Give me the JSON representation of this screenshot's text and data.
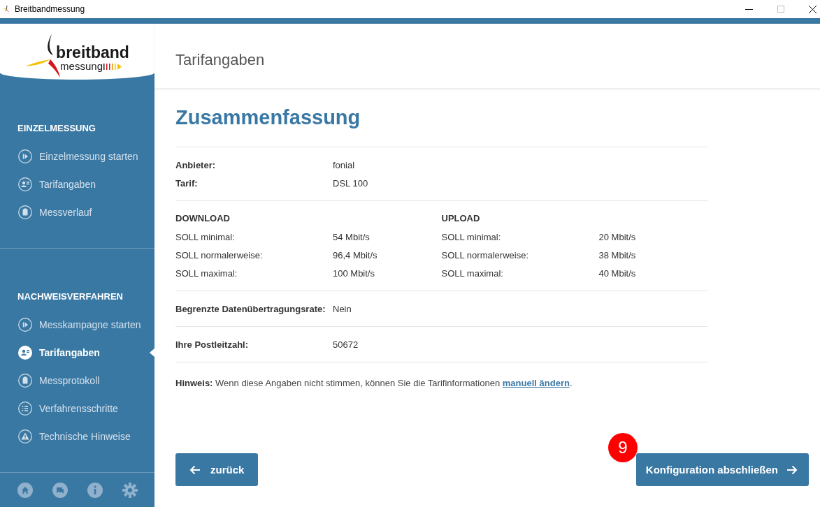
{
  "window": {
    "title": "Breitbandmessung"
  },
  "logo": {
    "line_1": "breitband",
    "line_2": "messung"
  },
  "sidebar": {
    "sections": [
      {
        "heading": "EINZELMESSUNG",
        "items": [
          {
            "label": "Einzelmessung starten",
            "kind": "play",
            "selected": false
          },
          {
            "label": "Tarifangaben",
            "kind": "person",
            "selected": false
          },
          {
            "label": "Messverlauf",
            "kind": "clipboard",
            "selected": false
          }
        ]
      },
      {
        "heading": "NACHWEISVERFAHREN",
        "items": [
          {
            "label": "Messkampagne starten",
            "kind": "play",
            "selected": false
          },
          {
            "label": "Tarifangaben",
            "kind": "person",
            "selected": true
          },
          {
            "label": "Messprotokoll",
            "kind": "clipboard",
            "selected": false
          },
          {
            "label": "Verfahrensschritte",
            "kind": "list",
            "selected": false
          },
          {
            "label": "Technische Hinweise",
            "kind": "warning",
            "selected": false
          }
        ]
      }
    ]
  },
  "page_title": "Tarifangaben",
  "heading": "Zusammenfassung",
  "contract": [
    {
      "label": "Anbieter:",
      "value": "fonial"
    },
    {
      "label": "Tarif:",
      "value": "DSL 100"
    }
  ],
  "speeds": [
    {
      "heading": "DOWNLOAD",
      "rows": [
        {
          "label": "SOLL minimal:",
          "value": "54 Mbit/s"
        },
        {
          "label": "SOLL normalerweise:",
          "value": "96,4 Mbit/s"
        },
        {
          "label": "SOLL maximal:",
          "value": "100 Mbit/s"
        }
      ]
    },
    {
      "heading": "UPLOAD",
      "rows": [
        {
          "label": "SOLL minimal:",
          "value": "20 Mbit/s"
        },
        {
          "label": "SOLL normalerweise:",
          "value": "38 Mbit/s"
        },
        {
          "label": "SOLL maximal:",
          "value": "40 Mbit/s"
        }
      ]
    }
  ],
  "details": [
    {
      "label": "Begrenzte Datenübertragungsrate:",
      "value": "Nein"
    },
    {
      "label": "Ihre Postleitzahl:",
      "value": "50672"
    }
  ],
  "hint": {
    "text": "**Hinweis:** Wenn diese Angaben nicht stimmen, können Sie die Tarifinformationen ",
    "link": "manuell ändern",
    "after": "."
  },
  "buttons": {
    "back": "zurück",
    "finish": "Konfiguration abschließen"
  },
  "step_badge": "9"
}
